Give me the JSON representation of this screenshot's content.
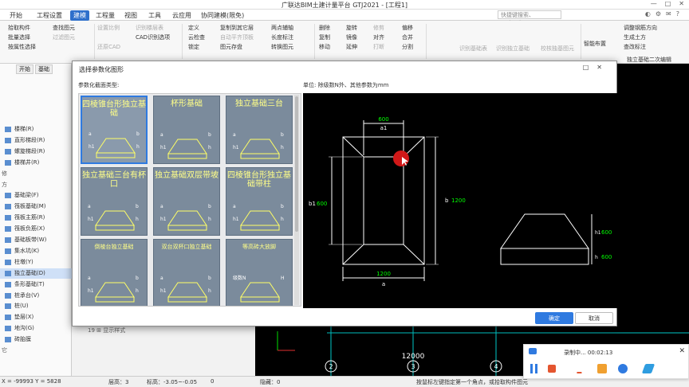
{
  "app": {
    "title": "广联达BIM土建计量平台 GTJ2021 - [工程1]"
  },
  "menu": [
    "开始",
    "工程设置",
    "建模",
    "工程量",
    "视图",
    "工具",
    "云应用",
    "协同建模(限免)"
  ],
  "menu_active_index": 2,
  "search_placeholder": "快捷键搜索、Ctrl+Alt+E",
  "ribbon": {
    "pick": "拾取构件",
    "batch": "批量选择",
    "attr": "按属性选择",
    "find": "查找图元",
    "filter": "过滤图元",
    "setratio": "设置比例",
    "restore": "还原CAD",
    "rec_axis": "识别楼层表",
    "cad_attr": "CAD识别选项",
    "define": "定义",
    "cloud_check": "云检查",
    "lock": "锁定",
    "copy_floor": "复制到其它层",
    "auto_level": "自动平齐顶板",
    "elem_store": "图元存盘",
    "twopoint": "两点辅轴",
    "length_mark": "长度标注",
    "convert": "转换图元",
    "delete": "删除",
    "copy": "复制",
    "move": "移动",
    "rotate": "旋转",
    "mirror": "镜像",
    "extend": "延伸",
    "trim": "修剪",
    "align": "对齐",
    "merge": "合并",
    "offset": "偏移",
    "split": "分割",
    "break": "打断",
    "rec_table": "识别基础表",
    "rec_found": "识别独立基础",
    "check_pos": "校核独基图元",
    "smart_layout": "智能布置",
    "adjust_dir": "调整钢筋方向",
    "gen_side": "生成土方",
    "view_label": "查改标注",
    "group": "独立基础二次编辑"
  },
  "left_panel": {
    "tabs": [
      "开始",
      "基础"
    ],
    "items": [
      {
        "label": "楼梯(R)",
        "sel": false
      },
      {
        "label": "直形梯段(R)",
        "sel": false
      },
      {
        "label": "螺旋梯段(R)",
        "sel": false
      },
      {
        "label": "楼梯井(R)",
        "sel": false
      },
      {
        "label": "修",
        "sec": true
      },
      {
        "label": "方",
        "sec": true
      },
      {
        "label": "基础梁(F)",
        "sel": false
      },
      {
        "label": "筏板基础(M)",
        "sel": false
      },
      {
        "label": "筏板主筋(R)",
        "sel": false
      },
      {
        "label": "筏板负筋(X)",
        "sel": false
      },
      {
        "label": "基础板带(W)",
        "sel": false
      },
      {
        "label": "集水坑(K)",
        "sel": false
      },
      {
        "label": "柱墩(Y)",
        "sel": false
      },
      {
        "label": "独立基础(D)",
        "sel": true
      },
      {
        "label": "条形基础(T)",
        "sel": false
      },
      {
        "label": "桩承台(V)",
        "sel": false
      },
      {
        "label": "桩(U)",
        "sel": false
      },
      {
        "label": "垫层(X)",
        "sel": false
      },
      {
        "label": "地沟(G)",
        "sel": false
      },
      {
        "label": "砖胎膜",
        "sel": false
      },
      {
        "label": "它",
        "sec": true
      }
    ]
  },
  "mid_panel": {
    "row19": "19 ⊞ 显示样式"
  },
  "dialog": {
    "title": "选择参数化图形",
    "type_label": "参数化截面类型:",
    "unit_label": "单位:  除级数N外、其他参数为mm",
    "ok": "确定",
    "cancel": "取消",
    "shapes": [
      {
        "name": "四棱锥台形独立基础",
        "sel": true
      },
      {
        "name": "杯形基础",
        "sel": false
      },
      {
        "name": "独立基础三台",
        "sel": false
      },
      {
        "name": "独立基础三台有杯口",
        "sel": false
      },
      {
        "name": "独立基础双层带坡",
        "sel": false
      },
      {
        "name": "四棱锥台形独立基础带柱",
        "sel": false
      },
      {
        "name": "倒棱台独立基础",
        "sel": false
      },
      {
        "name": "双台双杯口独立基础",
        "sel": false
      },
      {
        "name": "等高砖大放脚",
        "sel": false
      }
    ],
    "thumb_labels": {
      "a": "a",
      "b": "b",
      "a1": "a1",
      "b1": "b1",
      "h": "h",
      "h1": "h1",
      "N": "级数N",
      "H": "H"
    },
    "preview": {
      "top_a1": "600",
      "top_a1_sym": "a1",
      "bottom_a": "1200",
      "bottom_a_sym": "a",
      "left_b1_sym": "b1",
      "left_b1": "600",
      "right_b_sym": "b",
      "right_b": "1200",
      "side_h1_sym": "h1",
      "side_h1": "600",
      "side_h_sym": "h",
      "side_h": "600"
    }
  },
  "canvas": {
    "axis_12000": "12000",
    "axis_nums": [
      "2",
      "3",
      "4"
    ]
  },
  "status": {
    "coord": "X = -99993  Y = 5828",
    "floor": "层高：3",
    "elev": "标高：-3.05~-0.05",
    "zero": "0",
    "hidden": "隐藏：0",
    "hint": "按鼠标左键指定第一个角点，或拾取构件图元"
  },
  "recorder": {
    "text": "录制中... 00:02:13"
  },
  "colors": {
    "accent": "#2f7ae0",
    "selected": "#cfe0f7",
    "cad_line": "#ffffff",
    "dim_text": "#00ff00",
    "cursor": "#ff2a2a"
  }
}
